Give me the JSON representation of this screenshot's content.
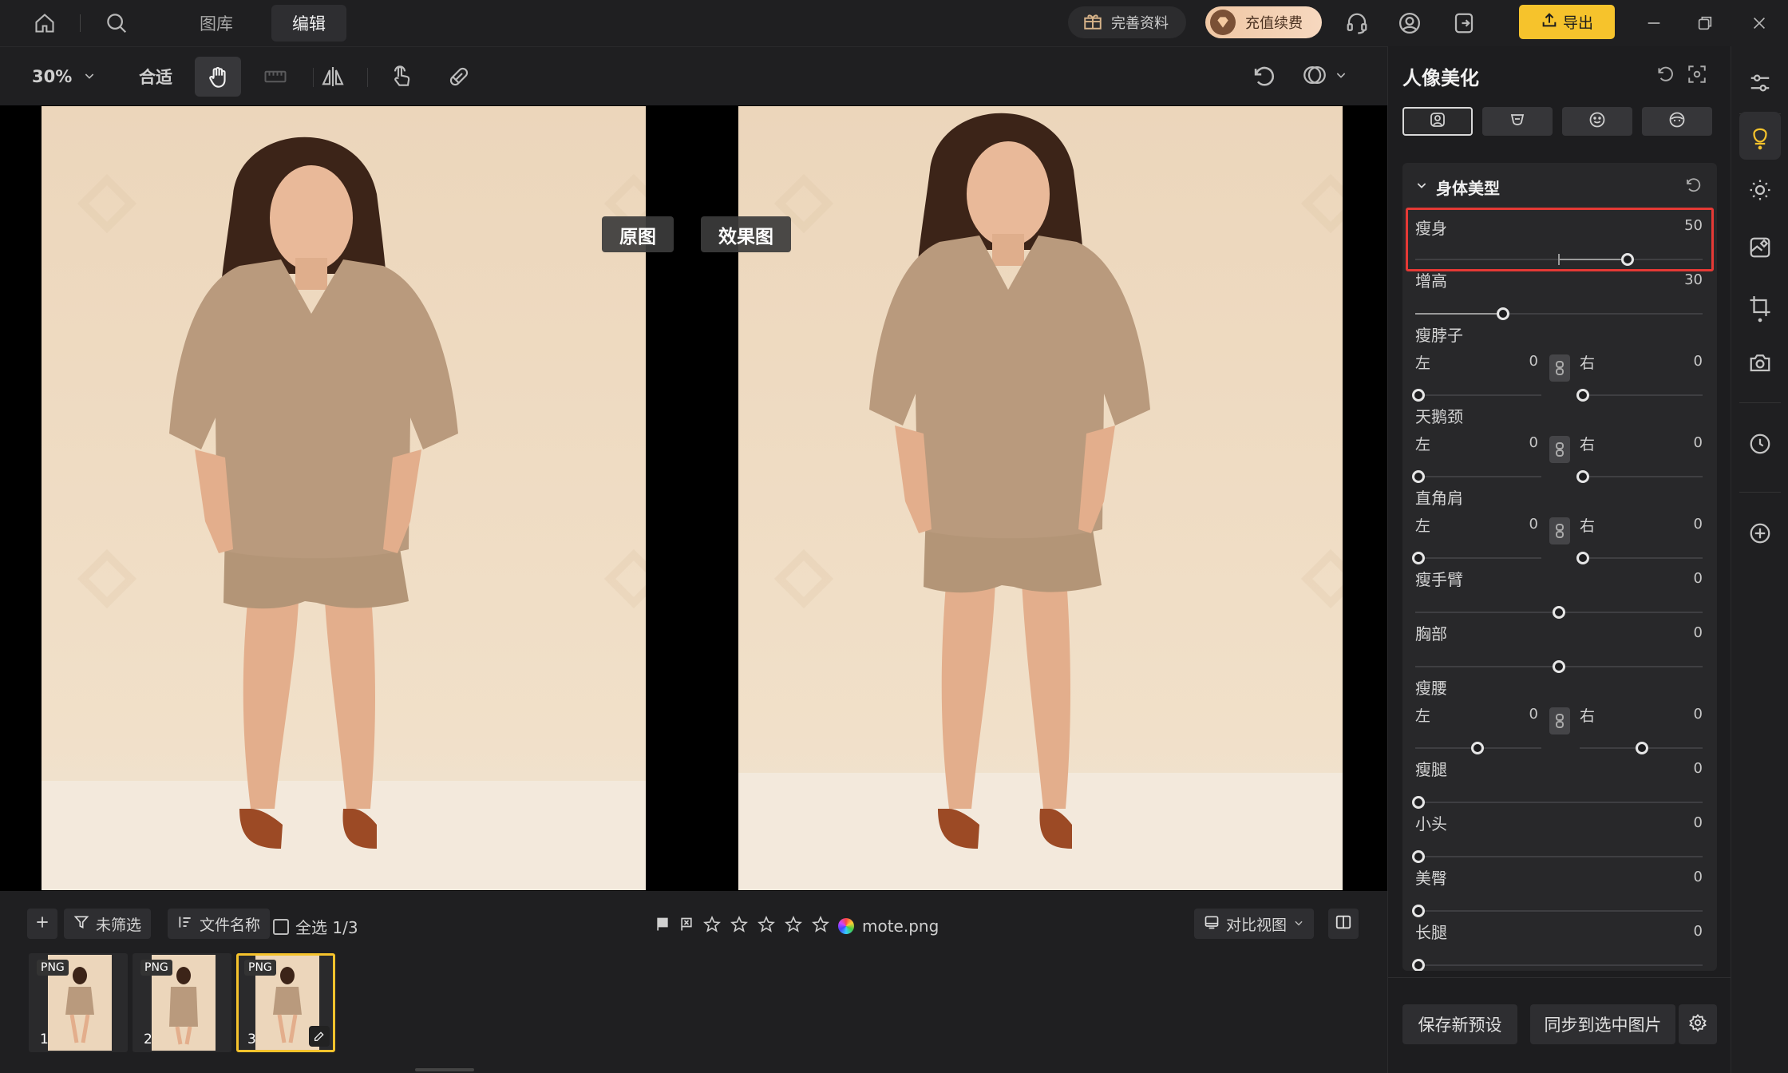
{
  "topbar": {
    "tabs": [
      "图库",
      "编辑"
    ],
    "active_tab": "编辑",
    "complete_profile": "完善资料",
    "recharge": "充值续费",
    "export": "导出"
  },
  "toolbar": {
    "zoom": "30%",
    "fit": "合适"
  },
  "compare": {
    "original_label": "原图",
    "effect_label": "效果图"
  },
  "filmstrip": {
    "filter_label": "未筛选",
    "sort_label": "文件名称",
    "select_all": "全选 1/3",
    "filename": "mote.png",
    "compare_view": "对比视图",
    "thumbs": [
      {
        "badge": "PNG",
        "num": "1"
      },
      {
        "badge": "PNG",
        "num": "2"
      },
      {
        "badge": "PNG",
        "num": "3"
      }
    ],
    "rating_stars": 0
  },
  "panel": {
    "title": "人像美化",
    "section_title": "身体美型",
    "left_text": "左",
    "right_text": "右",
    "items": [
      {
        "name": "瘦身",
        "value": "50"
      },
      {
        "name": "增高",
        "value": "30"
      },
      {
        "name": "瘦脖子",
        "left": "0",
        "right": "0"
      },
      {
        "name": "天鹅颈",
        "left": "0",
        "right": "0"
      },
      {
        "name": "直角肩",
        "left": "0",
        "right": "0"
      },
      {
        "name": "瘦手臂",
        "value": "0"
      },
      {
        "name": "胸部",
        "value": "0"
      },
      {
        "name": "瘦腰",
        "left": "0",
        "right": "0"
      },
      {
        "name": "瘦腿",
        "value": "0"
      },
      {
        "name": "小头",
        "value": "0"
      },
      {
        "name": "美臀",
        "value": "0"
      },
      {
        "name": "长腿",
        "value": "0"
      }
    ],
    "save_preset": "保存新预设",
    "sync_selected": "同步到选中图片"
  },
  "colors": {
    "accent": "#f6c32c",
    "highlight": "#e53935",
    "backdrop": "#efdcc4",
    "shirt": "#b99a7d"
  }
}
